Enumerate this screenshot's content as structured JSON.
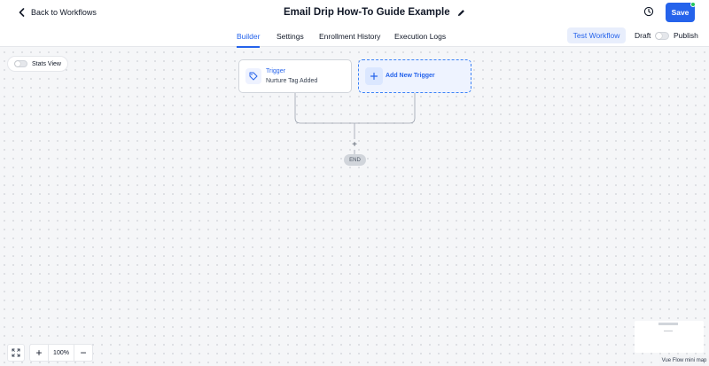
{
  "header": {
    "back_label": "Back to Workflows",
    "title": "Email Drip How-To Guide Example",
    "save_label": "Save"
  },
  "tabs": [
    {
      "label": "Builder",
      "active": true
    },
    {
      "label": "Settings",
      "active": false
    },
    {
      "label": "Enrollment History",
      "active": false
    },
    {
      "label": "Execution Logs",
      "active": false
    }
  ],
  "toolbar": {
    "test_label": "Test Workflow",
    "draft_label": "Draft",
    "publish_label": "Publish"
  },
  "canvas": {
    "stats_label": "Stats View",
    "trigger_node": {
      "title": "Trigger",
      "subtitle": "Nurture Tag Added"
    },
    "add_trigger_label": "Add New Trigger",
    "plus_label": "+",
    "end_label": "END"
  },
  "zoom": {
    "zoom_in": "+",
    "value": "100%",
    "zoom_out": "−"
  },
  "minimap": {
    "label": "Vue Flow mini map"
  },
  "colors": {
    "accent": "#2563eb",
    "status_green": "#22c55e"
  }
}
